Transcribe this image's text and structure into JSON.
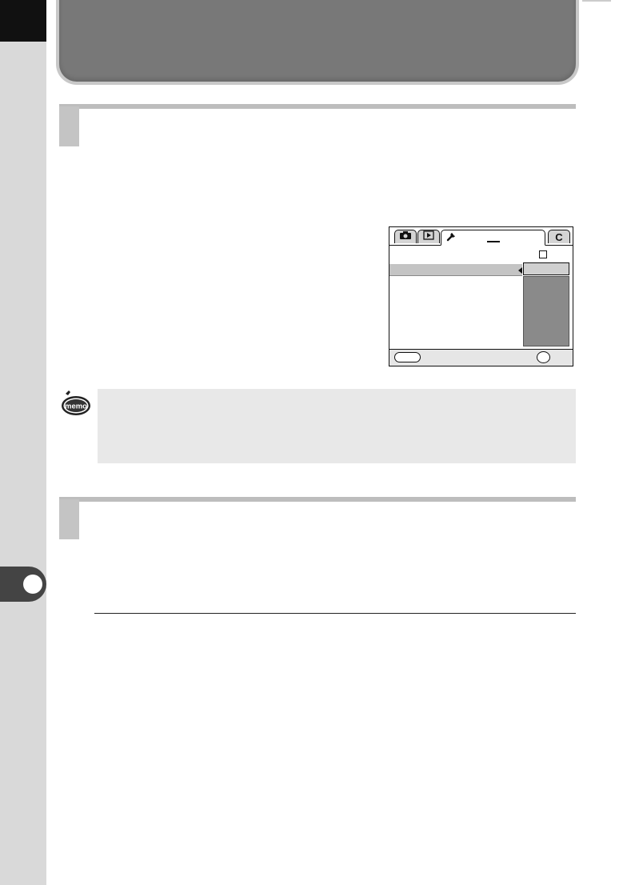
{
  "camera_screen": {
    "tabs": [
      {
        "icon": "camera-icon"
      },
      {
        "icon": "playback-icon"
      },
      {
        "icon": "wrench-icon"
      },
      {
        "label": "C"
      }
    ]
  },
  "memo_icon": {
    "label": "memo"
  }
}
